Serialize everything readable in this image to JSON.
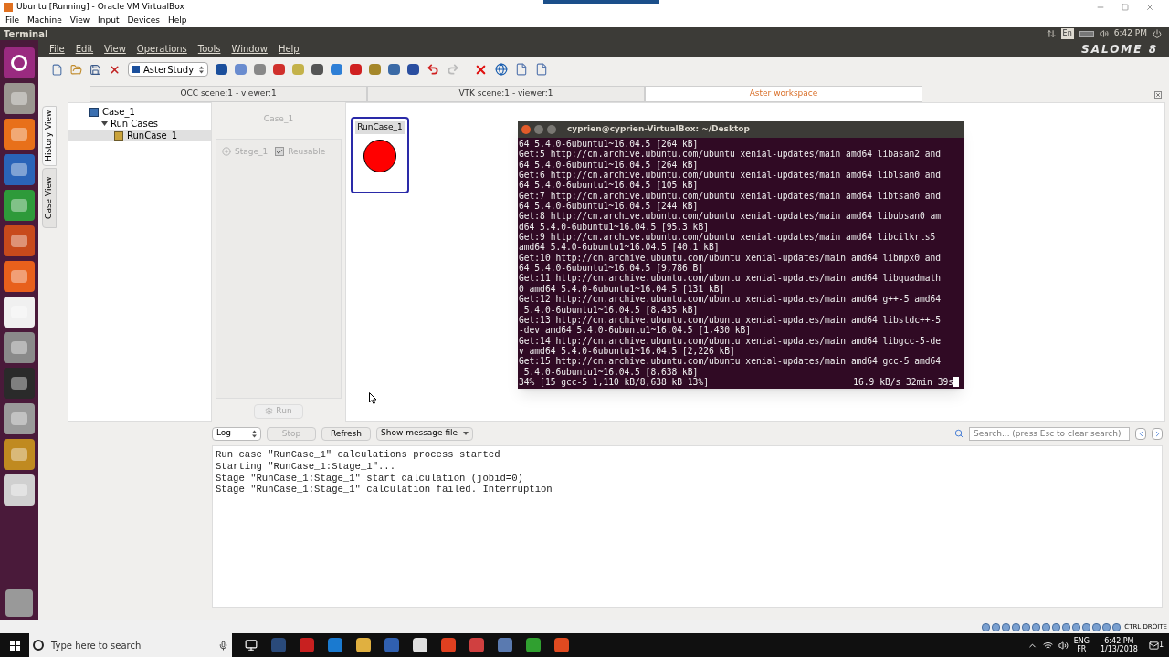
{
  "vbox": {
    "title": "Ubuntu [Running] - Oracle VM VirtualBox",
    "menu": [
      "File",
      "Machine",
      "View",
      "Input",
      "Devices",
      "Help"
    ]
  },
  "ubuntu_bar": {
    "app_title": "Terminal",
    "keyboard": "En",
    "clock": "6:42 PM",
    "brand": "SALOME 8"
  },
  "salome_menu": [
    "File",
    "Edit",
    "View",
    "Operations",
    "Tools",
    "Window",
    "Help"
  ],
  "module_select": "AsterStudy",
  "tabs": [
    {
      "label": "OCC scene:1 - viewer:1",
      "selected": false
    },
    {
      "label": "VTK scene:1 - viewer:1",
      "selected": false
    },
    {
      "label": "Aster workspace",
      "selected": true
    }
  ],
  "side_tabs": [
    {
      "label": "History View",
      "selected": true
    },
    {
      "label": "Case View",
      "selected": false
    }
  ],
  "tree": {
    "label": "Case_1",
    "children": [
      {
        "label": "Run Cases",
        "expanded": true,
        "children": [
          {
            "label": "RunCase_1",
            "selected": true
          }
        ]
      }
    ]
  },
  "case_panel": {
    "title": "Case_1",
    "stage": {
      "label": "Stage_1",
      "disabled": true
    },
    "reusable": {
      "label": "Reusable",
      "checked": true,
      "disabled": true
    },
    "run_button": {
      "label": "Run",
      "disabled": true
    }
  },
  "graph_node": {
    "label": "RunCase_1",
    "color": "#ff0000"
  },
  "terminal": {
    "title": "cyprien@cyprien-VirtualBox: ~/Desktop",
    "lines": [
      "64 5.4.0-6ubuntu1~16.04.5 [264 kB]",
      "Get:5 http://cn.archive.ubuntu.com/ubuntu xenial-updates/main amd64 libasan2 and",
      "64 5.4.0-6ubuntu1~16.04.5 [264 kB]",
      "Get:6 http://cn.archive.ubuntu.com/ubuntu xenial-updates/main amd64 liblsan0 and",
      "64 5.4.0-6ubuntu1~16.04.5 [105 kB]",
      "Get:7 http://cn.archive.ubuntu.com/ubuntu xenial-updates/main amd64 libtsan0 and",
      "64 5.4.0-6ubuntu1~16.04.5 [244 kB]",
      "Get:8 http://cn.archive.ubuntu.com/ubuntu xenial-updates/main amd64 libubsan0 am",
      "d64 5.4.0-6ubuntu1~16.04.5 [95.3 kB]",
      "Get:9 http://cn.archive.ubuntu.com/ubuntu xenial-updates/main amd64 libcilkrts5",
      "amd64 5.4.0-6ubuntu1~16.04.5 [40.1 kB]",
      "Get:10 http://cn.archive.ubuntu.com/ubuntu xenial-updates/main amd64 libmpx0 and",
      "64 5.4.0-6ubuntu1~16.04.5 [9,786 B]",
      "Get:11 http://cn.archive.ubuntu.com/ubuntu xenial-updates/main amd64 libquadmath",
      "0 amd64 5.4.0-6ubuntu1~16.04.5 [131 kB]",
      "Get:12 http://cn.archive.ubuntu.com/ubuntu xenial-updates/main amd64 g++-5 amd64",
      " 5.4.0-6ubuntu1~16.04.5 [8,435 kB]",
      "Get:13 http://cn.archive.ubuntu.com/ubuntu xenial-updates/main amd64 libstdc++-5",
      "-dev amd64 5.4.0-6ubuntu1~16.04.5 [1,430 kB]",
      "Get:14 http://cn.archive.ubuntu.com/ubuntu xenial-updates/main amd64 libgcc-5-de",
      "v amd64 5.4.0-6ubuntu1~16.04.5 [2,226 kB]",
      "Get:15 http://cn.archive.ubuntu.com/ubuntu xenial-updates/main amd64 gcc-5 amd64",
      " 5.4.0-6ubuntu1~16.04.5 [8,638 kB]"
    ],
    "progress": "34% [15 gcc-5 1,110 kB/8,638 kB 13%]",
    "rate": "16.9 kB/s 32min 39s"
  },
  "log_toolbar": {
    "combo": "Log",
    "buttons": [
      {
        "label": "Stop",
        "disabled": true
      },
      {
        "label": "Refresh",
        "disabled": false
      }
    ],
    "message_file": "Show message file",
    "search_placeholder": "Search... (press Esc to clear search)"
  },
  "log_lines": [
    "Run case \"RunCase_1\" calculations process started",
    "Starting \"RunCase_1:Stage_1\"...",
    "Stage \"RunCase_1:Stage_1\" start calculation (jobid=0)",
    "Stage \"RunCase_1:Stage_1\" calculation failed. Interruption"
  ],
  "vbox_status": "CTRL DROITE",
  "taskbar": {
    "search_placeholder": "Type here to search",
    "lang_top": "ENG",
    "lang_bottom": "FR",
    "time": "6:42 PM",
    "date": "1/13/2018",
    "notifications": "1"
  }
}
